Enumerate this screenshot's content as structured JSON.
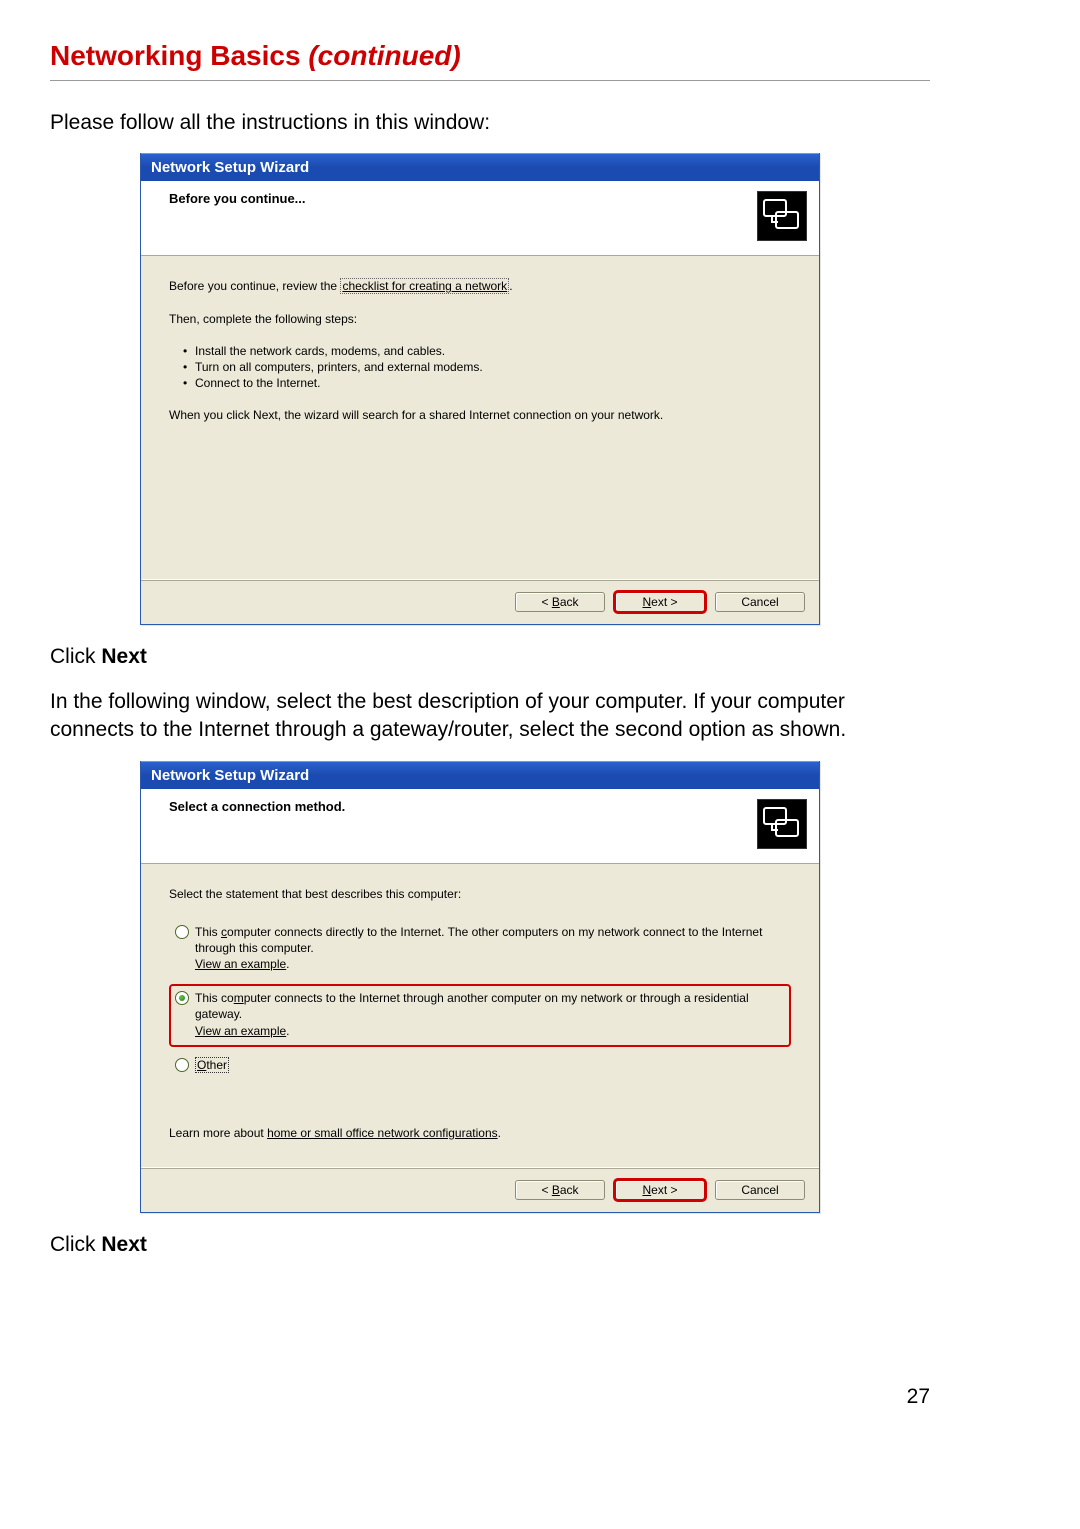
{
  "page": {
    "title_main": "Networking Basics ",
    "title_suffix": "(continued)",
    "intro": "Please follow all the instructions in this window:",
    "click_next_1a": "Click ",
    "click_next_1b": "Next",
    "mid_para": "In the following window, select the best description of your computer.  If your computer connects to the Internet through a gateway/router, select the second option as shown.",
    "click_next_2a": "Click ",
    "click_next_2b": "Next",
    "number": "27"
  },
  "wiz1": {
    "title": "Network Setup Wizard",
    "heading": "Before you continue...",
    "line1_pre": "Before you continue, review the ",
    "line1_link": "checklist for creating a network",
    "line1_post": ".",
    "line2": "Then, complete the following steps:",
    "bullets": [
      "Install the network cards, modems, and cables.",
      "Turn on all computers, printers, and external modems.",
      "Connect to the Internet."
    ],
    "line3": "When you click Next, the wizard will search for a shared Internet connection on your network.",
    "back_pre": "< ",
    "back_u": "B",
    "back_post": "ack",
    "next_u": "N",
    "next_post": "ext >",
    "cancel": "Cancel"
  },
  "wiz2": {
    "title": "Network Setup Wizard",
    "heading": "Select a connection method.",
    "prompt": "Select the statement that best describes this computer:",
    "opt1_pre": "This ",
    "opt1_u": "c",
    "opt1_post": "omputer connects directly to the Internet. The other computers on my network connect to the Internet through this computer.",
    "view_example": "View an example",
    "opt2_pre": "This co",
    "opt2_u": "m",
    "opt2_post": "puter connects to the Internet through another computer on my network or through a residential gateway.",
    "opt3_u": "O",
    "opt3_post": "ther",
    "learn_pre": "Learn more about ",
    "learn_link": "home or small office network configurations",
    "learn_post": ".",
    "back_pre": "< ",
    "back_u": "B",
    "back_post": "ack",
    "next_u": "N",
    "next_post": "ext >",
    "cancel": "Cancel"
  }
}
